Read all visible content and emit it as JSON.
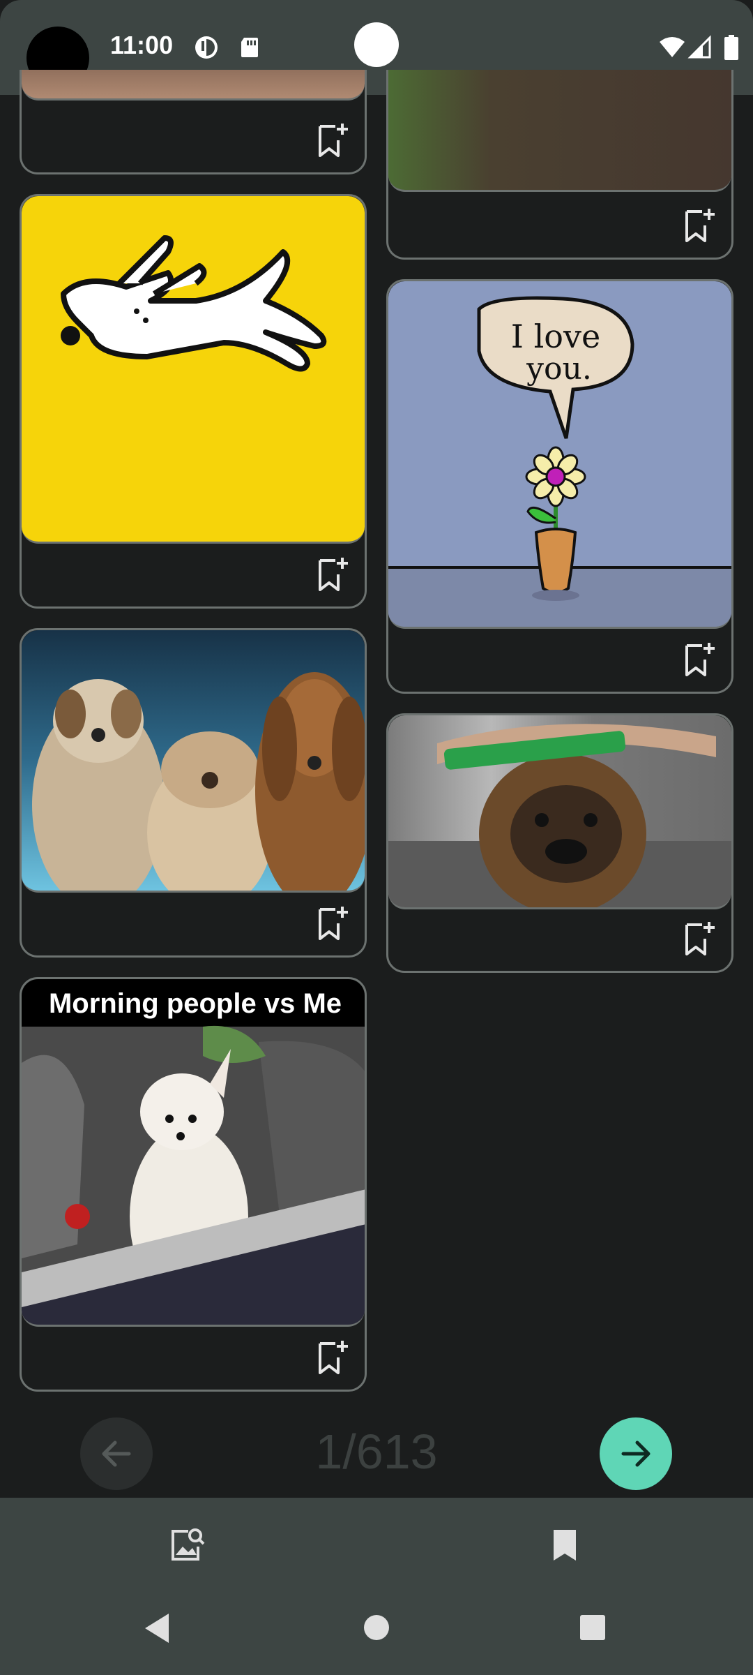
{
  "status_bar": {
    "time": "11:00"
  },
  "cards": [
    {
      "id": "card-partial-left",
      "image": "partial-image"
    },
    {
      "id": "card-partial-right",
      "image": "partial-image"
    },
    {
      "id": "card-yellow-dog",
      "image": "dog-on-yellow"
    },
    {
      "id": "card-i-love-you",
      "image": "flower-i-love-you",
      "speech_text": "I love you."
    },
    {
      "id": "card-three-dogs",
      "image": "three-dogs"
    },
    {
      "id": "card-pug-brush",
      "image": "dog-with-brush"
    },
    {
      "id": "card-morning-people",
      "image": "chihuahua-car",
      "caption": "Morning people vs Me"
    }
  ],
  "pager": {
    "current": "1/613"
  },
  "colors": {
    "background": "#1b1d1d",
    "bars": "#3d4543",
    "accent": "#5fd6b6",
    "card_border": "#6c7270"
  }
}
